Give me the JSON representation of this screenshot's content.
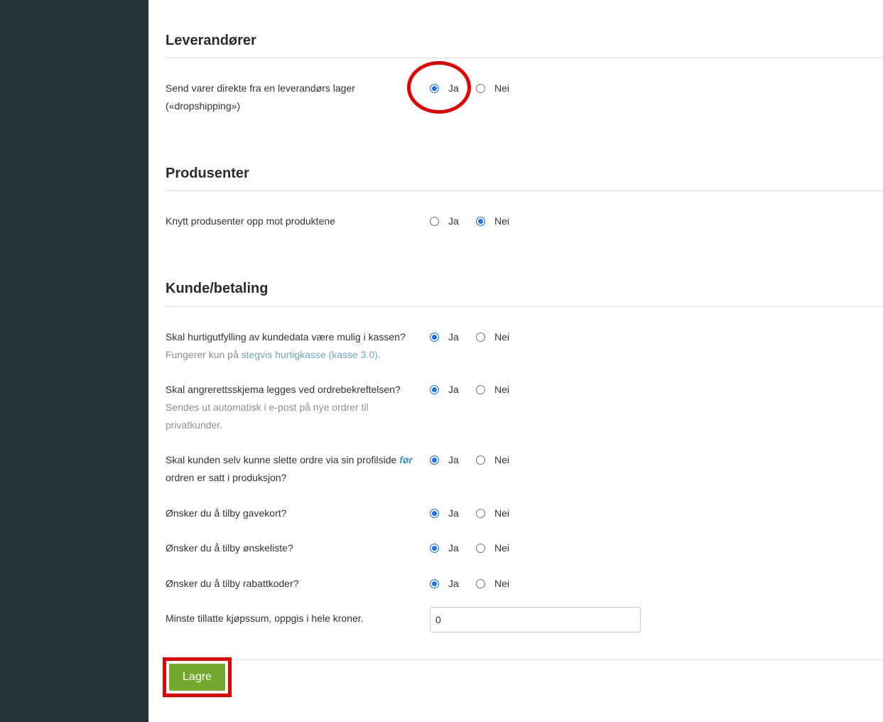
{
  "sections": {
    "suppliers": {
      "title": "Leverandører",
      "dropshipping": {
        "label": "Send varer direkte fra en leverandørs lager («dropshipping»)",
        "value": "Ja"
      }
    },
    "manufacturers": {
      "title": "Produsenter",
      "link_manufacturers": {
        "label": "Knytt produsenter opp mot produktene",
        "value": "Nei"
      }
    },
    "customer_payment": {
      "title": "Kunde/betaling",
      "quick_fill": {
        "label": "Skal hurtigutfylling av kundedata være mulig i kassen?",
        "help_prefix": "Fungerer kun på ",
        "help_link": "stegvis hurtigkasse (kasse 3.0)",
        "help_suffix": ".",
        "value": "Ja"
      },
      "cancellation_form": {
        "label": "Skal angrerettsskjema legges ved ordrebekreftelsen?",
        "help": "Sendes ut automatisk i e-post på nye ordrer til privatkunder.",
        "value": "Ja"
      },
      "delete_orders": {
        "label_part1": "Skal kunden selv kunne slette ordre via sin profilside ",
        "label_emph": "før",
        "label_part2": " ordren er satt i produksjon?",
        "value": "Ja"
      },
      "gift_cards": {
        "label": "Ønsker du å tilby gavekort?",
        "value": "Ja"
      },
      "wishlist": {
        "label": "Ønsker du å tilby ønskeliste?",
        "value": "Ja"
      },
      "discount_codes": {
        "label": "Ønsker du å tilby rabattkoder?",
        "value": "Ja"
      },
      "min_purchase": {
        "label": "Minste tillatte kjøpssum, oppgis i hele kroner.",
        "value": "0"
      }
    }
  },
  "options": {
    "yes": "Ja",
    "no": "Nei"
  },
  "save_label": "Lagre",
  "colors": {
    "sidebar": "#263238",
    "accent_button": "#74a82c",
    "radio_checked": "#1a73e8",
    "annotation": "#e00000",
    "link": "#6fa5c2"
  }
}
